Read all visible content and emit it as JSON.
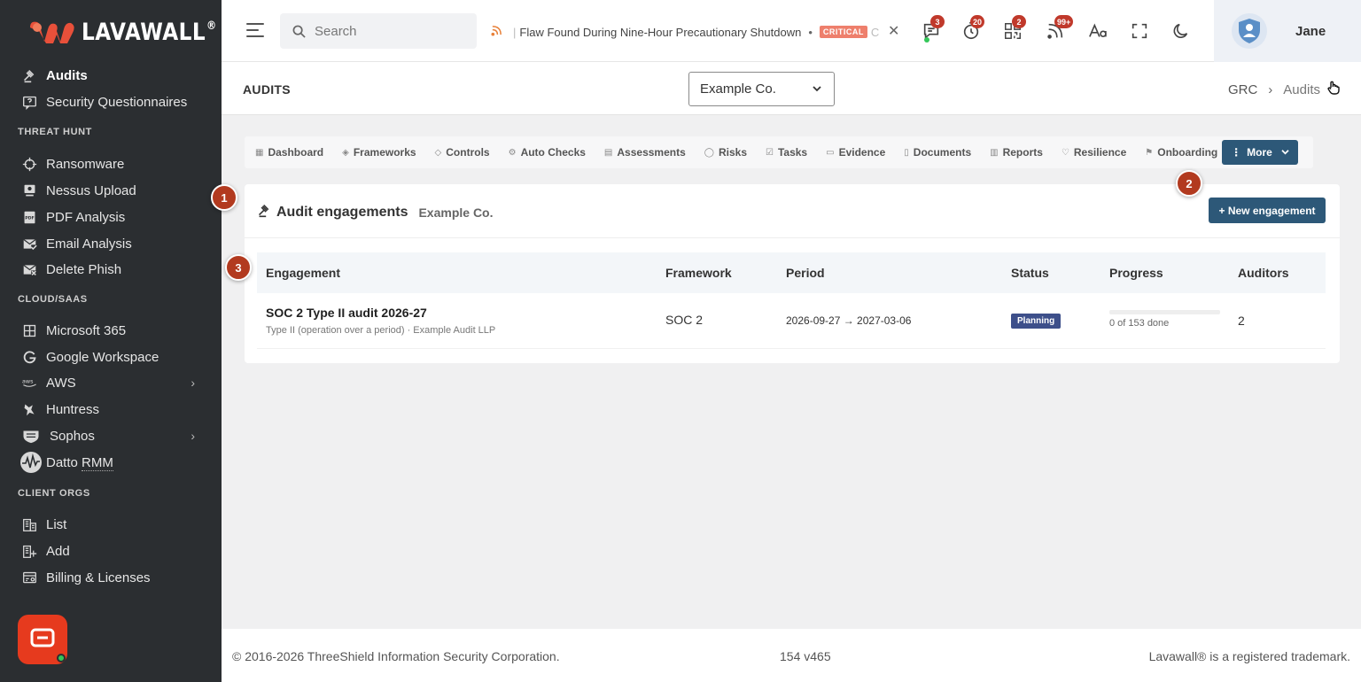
{
  "app": {
    "logo_lava": "LAVA",
    "logo_wall": "WALL",
    "logo_mark": "®"
  },
  "sidebar": {
    "items": [
      {
        "label": "Audits",
        "icon": "gavel-icon"
      },
      {
        "label": "Security Questionnaires",
        "icon": "question-icon"
      },
      {
        "label": "Ransomware",
        "icon": "crosshair-icon"
      },
      {
        "label": "Nessus Upload",
        "icon": "monitor-icon"
      },
      {
        "label": "PDF Analysis",
        "icon": "pdf-icon"
      },
      {
        "label": "Email Analysis",
        "icon": "mail-check-icon"
      },
      {
        "label": "Delete Phish",
        "icon": "mail-x-icon"
      },
      {
        "label": "Microsoft 365",
        "icon": "grid-icon"
      },
      {
        "label": "Google Workspace",
        "icon": "google-icon"
      },
      {
        "label": "AWS",
        "icon": "aws-icon"
      },
      {
        "label": "Huntress",
        "icon": "huntress-icon"
      },
      {
        "label": "Sophos",
        "icon": "shield-icon"
      },
      {
        "label_a": "Datto ",
        "label_b": "RMM",
        "icon": "pulse-icon"
      },
      {
        "label": "List",
        "icon": "building-icon"
      },
      {
        "label": "Add",
        "icon": "building-add-icon"
      },
      {
        "label": "Billing & Licenses",
        "icon": "billing-icon"
      }
    ],
    "sections": {
      "threat_hunt": "THREAT HUNT",
      "cloud_saas": "CLOUD/SAAS",
      "client_orgs": "CLIENT ORGS"
    }
  },
  "topbar": {
    "search_placeholder": "Search",
    "ticker_text": "Flaw Found During Nine-Hour Precautionary Shutdown",
    "ticker_bullet": "•",
    "ticker_badge": "CRITICAL",
    "ticker_tail": "C",
    "badges": {
      "messages": "3",
      "timer": "20",
      "qr": "2",
      "feed": "99+"
    },
    "user_name": "Jane"
  },
  "page": {
    "title": "AUDITS",
    "org_selected": "Example Co.",
    "breadcrumb": [
      "GRC",
      "Audits"
    ]
  },
  "tabs": {
    "items": [
      "Dashboard",
      "Frameworks",
      "Controls",
      "Auto Checks",
      "Assessments",
      "Risks",
      "Tasks",
      "Evidence",
      "Documents",
      "Reports",
      "Resilience",
      "Onboarding"
    ],
    "more_label": "More"
  },
  "card": {
    "title": "Audit engagements",
    "subtitle": "Example Co.",
    "new_button": "+ New engagement",
    "columns": [
      "Engagement",
      "Framework",
      "Period",
      "Status",
      "Progress",
      "Auditors"
    ],
    "rows": [
      {
        "name": "SOC 2 Type II audit 2026-27",
        "sub": "Type II (operation over a period) · Example Audit LLP",
        "framework": "SOC 2",
        "period": "2026-09-27 → 2027-03-06",
        "status": "Planning",
        "progress_text": "0 of 153 done",
        "progress_done": 0,
        "progress_total": 153,
        "auditors": "2"
      }
    ]
  },
  "markers": [
    "1",
    "2",
    "3"
  ],
  "footer": {
    "copyright": "© 2016-2026 ThreeShield Information Security Corporation.",
    "version": "154 v465",
    "trademark": "Lavawall® is a registered trademark."
  },
  "colors": {
    "sidebar_bg": "#2b2e31",
    "accent": "#2d5878",
    "marker": "#b23a1f",
    "brand_red": "#e63a1e"
  }
}
